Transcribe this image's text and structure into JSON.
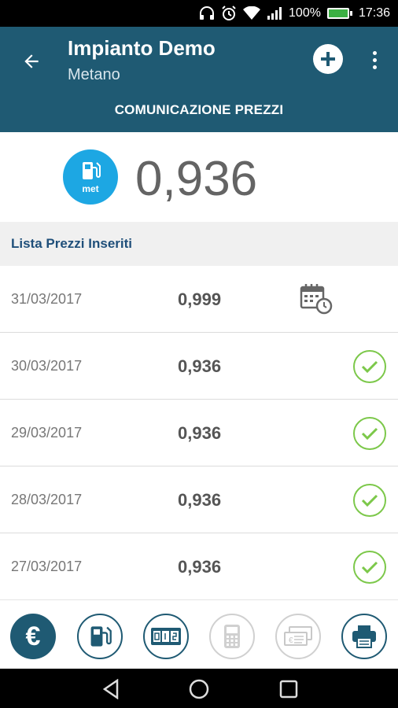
{
  "status_bar": {
    "battery": "100%",
    "time": "17:36"
  },
  "header": {
    "title": "Impianto Demo",
    "subtitle": "Metano",
    "section_title": "COMUNICAZIONE PREZZI"
  },
  "current": {
    "fuel_code": "met",
    "price": "0,936"
  },
  "list": {
    "title": "Lista Prezzi Inseriti",
    "rows": [
      {
        "date": "31/03/2017",
        "price": "0,999",
        "status": "scheduled-calendar-icon"
      },
      {
        "date": "30/03/2017",
        "price": "0,936",
        "status": "confirmed-check-icon"
      },
      {
        "date": "29/03/2017",
        "price": "0,936",
        "status": "confirmed-check-icon"
      },
      {
        "date": "28/03/2017",
        "price": "0,936",
        "status": "confirmed-check-icon"
      },
      {
        "date": "27/03/2017",
        "price": "0,936",
        "status": "confirmed-check-icon"
      }
    ]
  },
  "colors": {
    "primary": "#1f5a73",
    "accent": "#1da7e3",
    "check": "#7cc84a"
  }
}
